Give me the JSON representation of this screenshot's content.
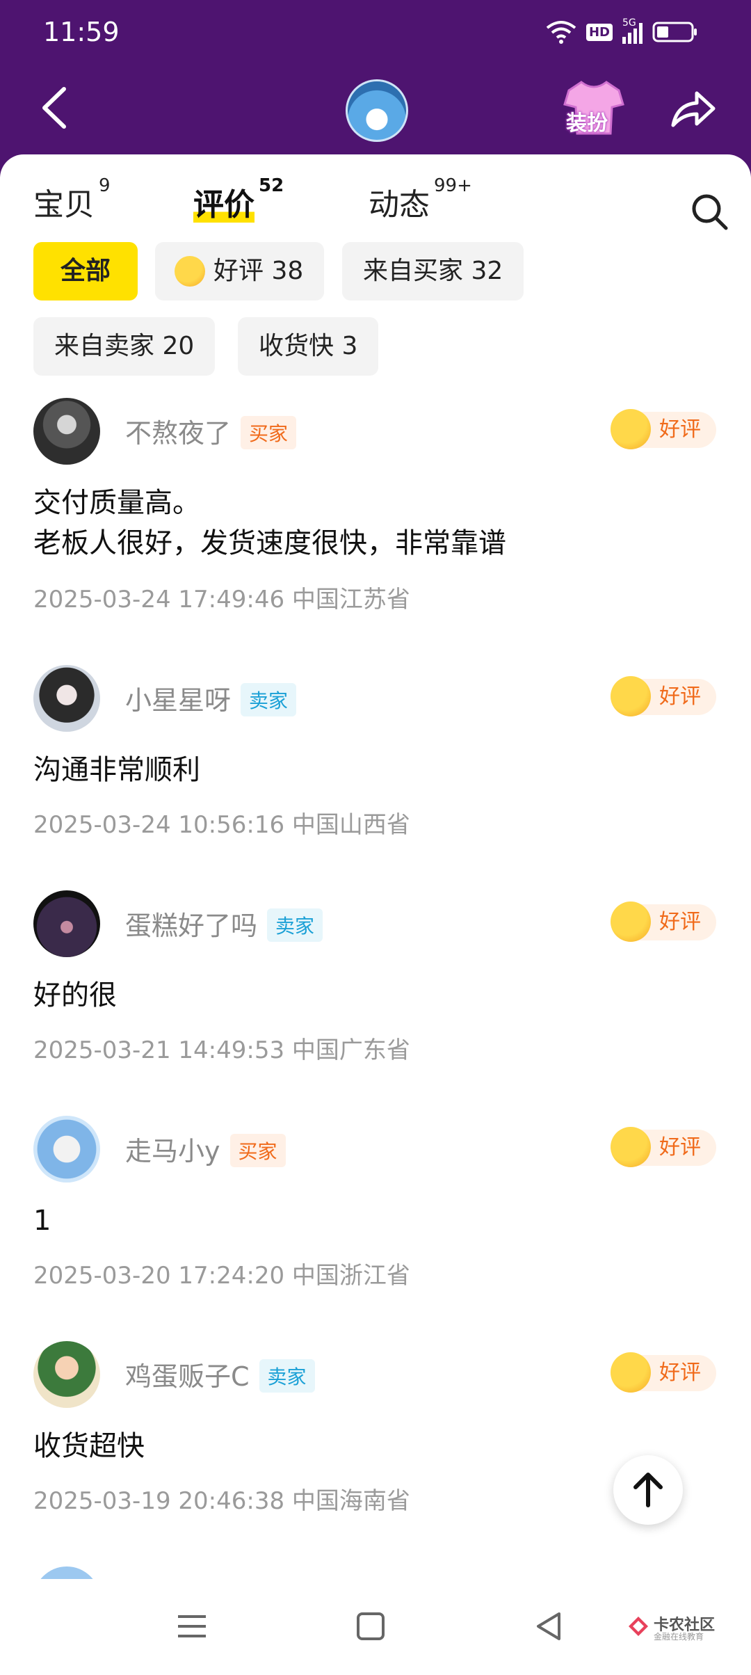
{
  "status_bar": {
    "time": "11:59",
    "hd": "HD",
    "net": "5G"
  },
  "header": {
    "dress_label": "装扮"
  },
  "tabs": [
    {
      "label": "宝贝",
      "count": "9"
    },
    {
      "label": "评价",
      "count": "52"
    },
    {
      "label": "动态",
      "count": "99+"
    }
  ],
  "filters": [
    {
      "label": "全部"
    },
    {
      "label": "好评 38"
    },
    {
      "label": "来自买家 32"
    },
    {
      "label": "来自卖家 20"
    },
    {
      "label": "收货快 3"
    }
  ],
  "reviews": [
    {
      "user": "不熬夜了",
      "role": "买家",
      "rating": "好评",
      "text_line1": "交付质量高。",
      "text_line2": "老板人很好，发货速度很快，非常靠谱",
      "date": "2025-03-24 17:49:46",
      "region": "中国江苏省"
    },
    {
      "user": "小星星呀",
      "role": "卖家",
      "rating": "好评",
      "text_line1": "沟通非常顺利",
      "date": "2025-03-24 10:56:16",
      "region": "中国山西省"
    },
    {
      "user": "蛋糕好了吗",
      "role": "卖家",
      "rating": "好评",
      "text_line1": "好的很",
      "date": "2025-03-21 14:49:53",
      "region": "中国广东省"
    },
    {
      "user": "走马小y",
      "role": "买家",
      "rating": "好评",
      "text_line1": "1",
      "date": "2025-03-20 17:24:20",
      "region": "中国浙江省"
    },
    {
      "user": "鸡蛋贩子C",
      "role": "卖家",
      "rating": "好评",
      "text_line1": "收货超快",
      "date": "2025-03-19 20:46:38",
      "region": "中国海南省"
    }
  ],
  "watermark": {
    "title": "卡农社区",
    "subtitle": "金融在线教育"
  },
  "colors": {
    "header_bg": "#4e1470",
    "active_chip": "#ffe100",
    "buyer": "#f06a1a",
    "seller": "#1aa0d6"
  }
}
